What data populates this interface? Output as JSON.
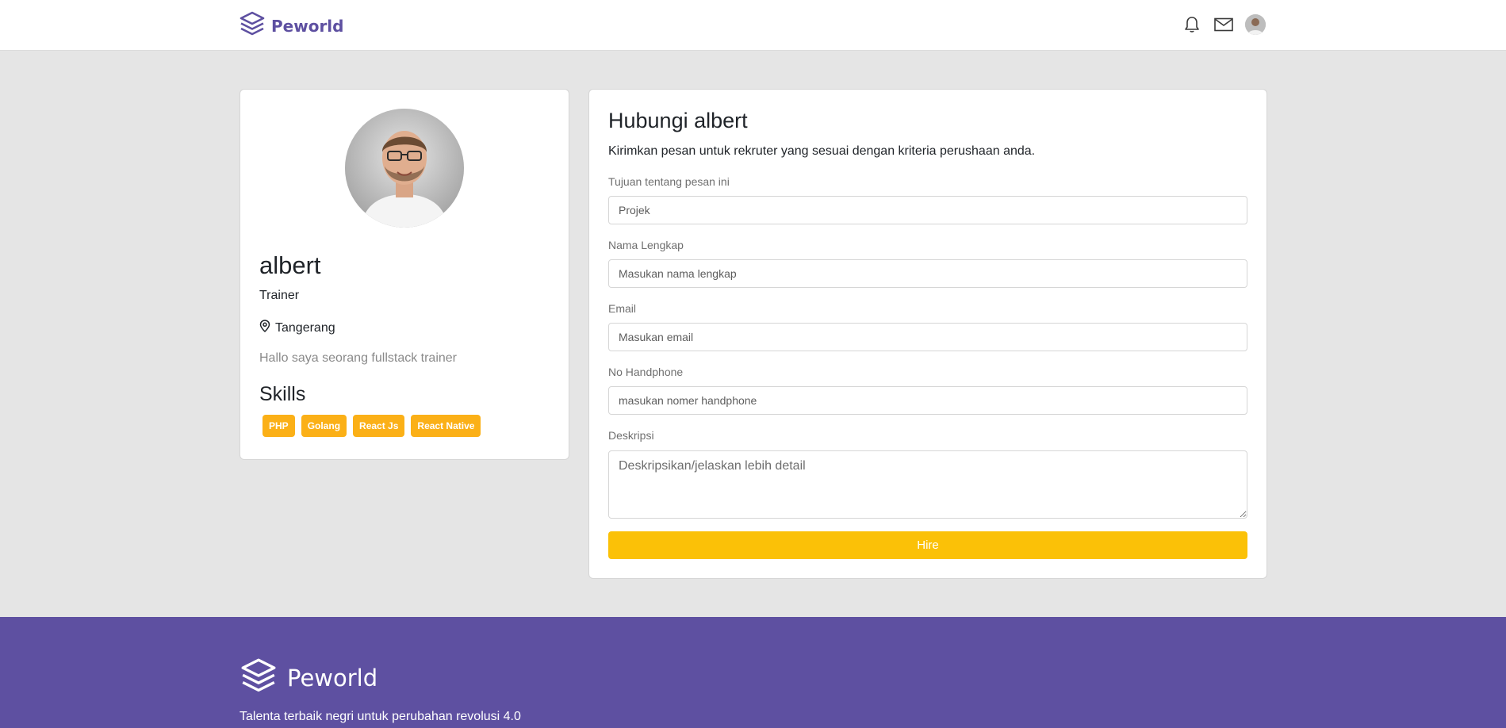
{
  "navbar": {
    "brand": "Peworld",
    "icons": [
      "bell-icon",
      "mail-icon",
      "user-avatar"
    ]
  },
  "profile": {
    "name": "albert",
    "role": "Trainer",
    "location": "Tangerang",
    "bio": "Hallo saya seorang fullstack trainer",
    "skills_title": "Skills",
    "skills": [
      "PHP",
      "Golang",
      "React Js",
      "React Native"
    ]
  },
  "contact": {
    "title": "Hubungi albert",
    "subtitle": "Kirimkan pesan untuk rekruter yang sesuai dengan kriteria perushaan anda.",
    "fields": [
      {
        "label": "Tujuan tentang pesan ini",
        "placeholder": "Projek"
      },
      {
        "label": "Nama Lengkap",
        "placeholder": "Masukan nama lengkap"
      },
      {
        "label": "Email",
        "placeholder": "Masukan email"
      },
      {
        "label": "No Handphone",
        "placeholder": "masukan nomer handphone"
      },
      {
        "label": "Deskripsi",
        "placeholder": "Deskripsikan/jelaskan lebih detail"
      }
    ],
    "submit_label": "Hire"
  },
  "footer": {
    "brand": "Peworld",
    "tagline": "Talenta terbaik negri untuk perubahan revolusi 4.0"
  },
  "colors": {
    "brand": "#5e50a1",
    "accent": "#fbb017",
    "background": "#e5e5e5"
  }
}
